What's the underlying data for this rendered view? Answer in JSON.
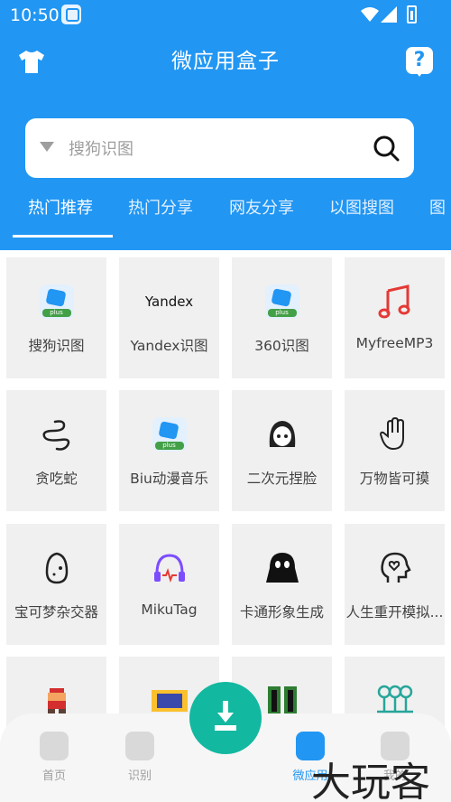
{
  "status_bar": {
    "time": "10:50"
  },
  "header": {
    "title": "微应用盒子",
    "help_label": "?"
  },
  "search": {
    "placeholder": "搜狗识图"
  },
  "tabs": [
    {
      "label": "热门推荐",
      "active": true
    },
    {
      "label": "热门分享"
    },
    {
      "label": "网友分享"
    },
    {
      "label": "以图搜图"
    },
    {
      "label": "图"
    }
  ],
  "apps": [
    {
      "label": "搜狗识图",
      "icon": "plus-app-icon"
    },
    {
      "label": "Yandex识图",
      "icon": "yandex-logo",
      "icon_text": "Yandex"
    },
    {
      "label": "360识图",
      "icon": "plus-app-icon"
    },
    {
      "label": "MyfreeMP3",
      "icon": "music-note-icon"
    },
    {
      "label": "贪吃蛇",
      "icon": "snake-icon"
    },
    {
      "label": "Biu动漫音乐",
      "icon": "plus-app-icon"
    },
    {
      "label": "二次元捏脸",
      "icon": "anime-face-icon"
    },
    {
      "label": "万物皆可摸",
      "icon": "hand-icon"
    },
    {
      "label": "宝可梦杂交器",
      "icon": "egg-icon"
    },
    {
      "label": "MikuTag",
      "icon": "headphones-icon"
    },
    {
      "label": "卡通形象生成",
      "icon": "ghost-icon"
    },
    {
      "label": "人生重开模拟...",
      "icon": "head-heart-icon"
    },
    {
      "label": "",
      "icon": "pixel-mario-icon"
    },
    {
      "label": "",
      "icon": "film-icon"
    },
    {
      "label": "",
      "icon": "pixel-grid-icon"
    },
    {
      "label": "",
      "icon": "trees-icon"
    }
  ],
  "bottom_nav": [
    {
      "label": "首页",
      "icon": "home-icon"
    },
    {
      "label": "识别",
      "icon": "bag-icon"
    },
    {
      "label": "微应用",
      "icon": "cube-icon",
      "active": true
    },
    {
      "label": "我的",
      "icon": "user-icon"
    }
  ],
  "download_button": {
    "icon": "download-icon"
  },
  "watermark": {
    "text": "大玩客"
  },
  "colors": {
    "primary": "#2196f3",
    "card": "#f0f0f0",
    "download": "#12b8a0",
    "music_red": "#e53935",
    "miku_purple": "#7c4dff"
  }
}
